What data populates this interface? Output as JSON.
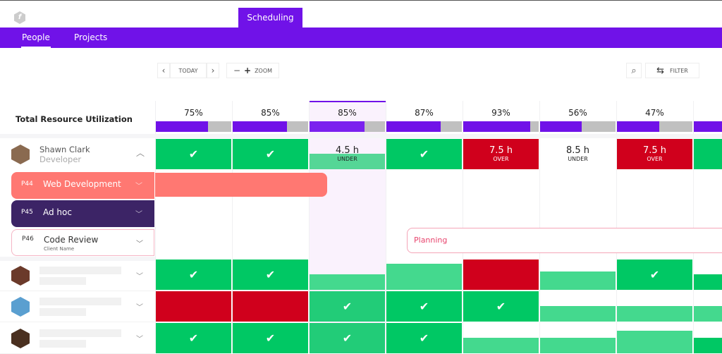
{
  "app": {
    "logo_glyph": "f",
    "active_module": "Scheduling"
  },
  "nav": {
    "tabs": [
      {
        "label": "People",
        "active": true
      },
      {
        "label": "Projects",
        "active": false
      }
    ]
  },
  "toolbar": {
    "prev_label": "‹",
    "today_label": "TODAY",
    "next_label": "›",
    "zoom_minus": "−",
    "zoom_plus": "+",
    "zoom_label": "ZOOM",
    "search_icon": "⌕",
    "filter_icon": "⇆",
    "filter_label": "FILTER"
  },
  "utilization": {
    "title": "Total Resource Utilization",
    "columns": [
      {
        "pct_label": "75%",
        "fill": 0.69
      },
      {
        "pct_label": "85%",
        "fill": 0.72
      },
      {
        "pct_label": "85%",
        "fill": 0.73,
        "selected": true
      },
      {
        "pct_label": "87%",
        "fill": 0.72
      },
      {
        "pct_label": "93%",
        "fill": 0.89
      },
      {
        "pct_label": "56%",
        "fill": 0.55
      },
      {
        "pct_label": "47%",
        "fill": 0.56
      },
      {
        "pct_label": "",
        "fill": 1.0
      }
    ]
  },
  "colors": {
    "brand": "#7012e8",
    "ok": "#00c864",
    "ok_light": "#44d98e",
    "ok_mid": "#22cc78",
    "over": "#d0001c",
    "web_dev": "#ff7872",
    "adhoc": "#3c2466",
    "planning": "#e8456e",
    "selected_col": "#faf2fd"
  },
  "people": [
    {
      "name": "Shawn Clark",
      "role": "Developer",
      "expanded": true,
      "avatar_color": "#8a6a50",
      "cells": [
        {
          "type": "check"
        },
        {
          "type": "check"
        },
        {
          "type": "under",
          "hours": "4.5 h",
          "label": "UNDER"
        },
        {
          "type": "check"
        },
        {
          "type": "over",
          "hours": "7.5 h",
          "label": "OVER"
        },
        {
          "type": "under-empty",
          "hours": "8.5 h",
          "label": "UNDER"
        },
        {
          "type": "over",
          "hours": "7.5 h",
          "label": "OVER"
        },
        {
          "type": "check"
        }
      ],
      "projects": [
        {
          "code": "P44",
          "name": "Web Development",
          "client": "",
          "style": "web"
        },
        {
          "code": "P45",
          "name": "Ad hoc",
          "client": "",
          "style": "adhoc"
        },
        {
          "code": "P46",
          "name": "Code Review",
          "client": "Client Name",
          "style": "outline"
        }
      ],
      "bars": [
        {
          "project": "Web Development",
          "label": ""
        },
        {
          "project": "Code Review",
          "label": "Planning"
        }
      ]
    },
    {
      "name": "",
      "role": "",
      "expanded": false,
      "avatar_color": "#6b3a2a"
    },
    {
      "name": "",
      "role": "",
      "expanded": false,
      "avatar_color": "#5a9fd0"
    },
    {
      "name": "",
      "role": "",
      "expanded": false,
      "avatar_color": "#4a3020"
    }
  ]
}
